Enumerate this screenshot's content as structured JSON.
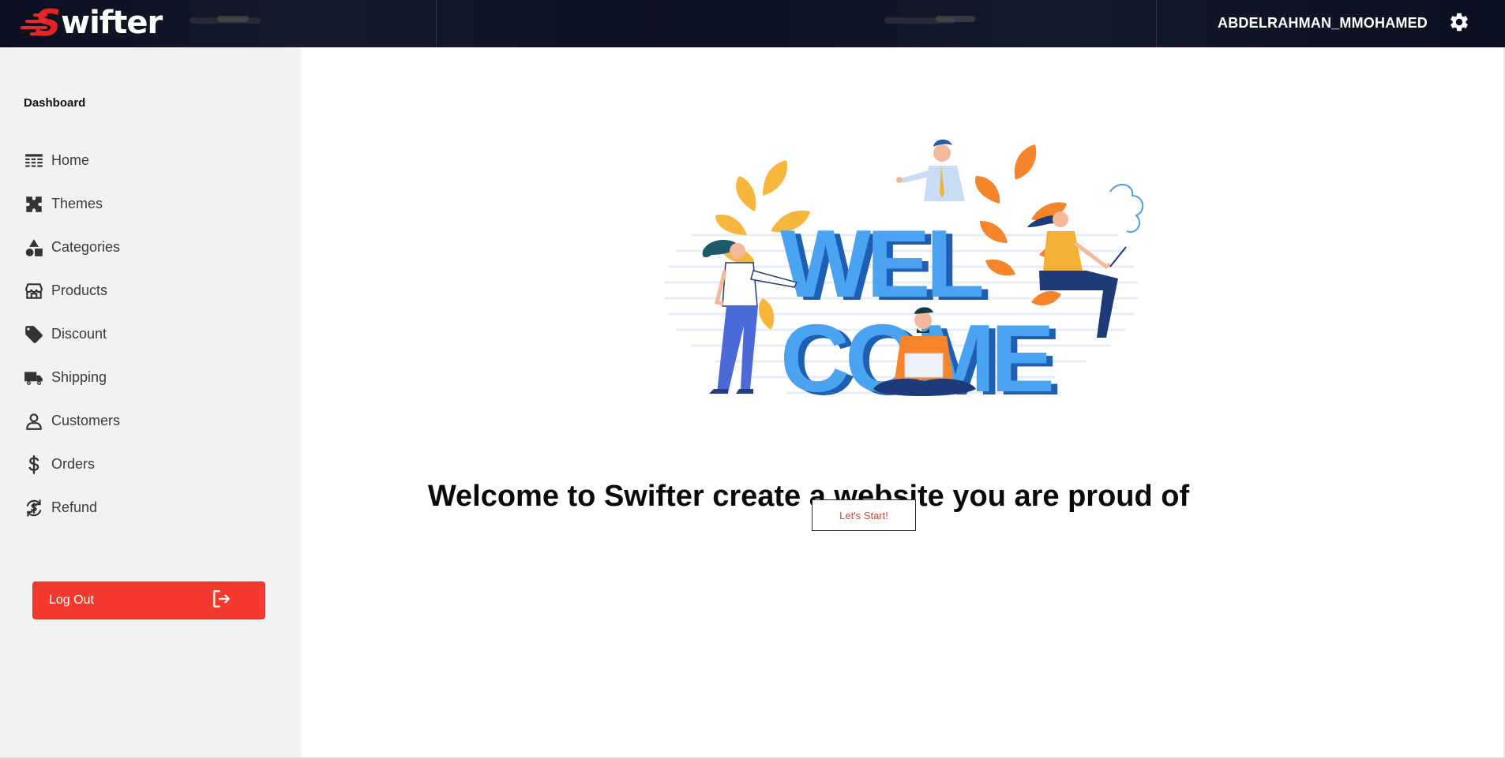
{
  "header": {
    "brand_initial": "S",
    "brand_rest": "wifter",
    "username": "ABDELRAHMAN_MMOHAMED",
    "settings_icon": "gear-icon"
  },
  "sidebar": {
    "title": "Dashboard",
    "items": [
      {
        "label": "Home",
        "icon": "home-grid-icon"
      },
      {
        "label": "Themes",
        "icon": "puzzle-icon"
      },
      {
        "label": "Categories",
        "icon": "shapes-icon"
      },
      {
        "label": "Products",
        "icon": "storefront-icon"
      },
      {
        "label": "Discount",
        "icon": "tag-icon"
      },
      {
        "label": "Shipping",
        "icon": "truck-icon"
      },
      {
        "label": "Customers",
        "icon": "person-icon"
      },
      {
        "label": "Orders",
        "icon": "dollar-icon"
      },
      {
        "label": "Refund",
        "icon": "refund-icon"
      }
    ],
    "logout_label": "Log Out"
  },
  "main": {
    "illustration_line1": "WEL",
    "illustration_line2": "COME",
    "headline": "Welcome to Swifter create a website you are proud of",
    "start_button": "Let's Start!"
  },
  "colors": {
    "accent_red": "#f4392f",
    "header_dark": "#0b1020",
    "sidebar_bg": "#f2f2f2",
    "welcome_blue": "#4aa3f0"
  }
}
